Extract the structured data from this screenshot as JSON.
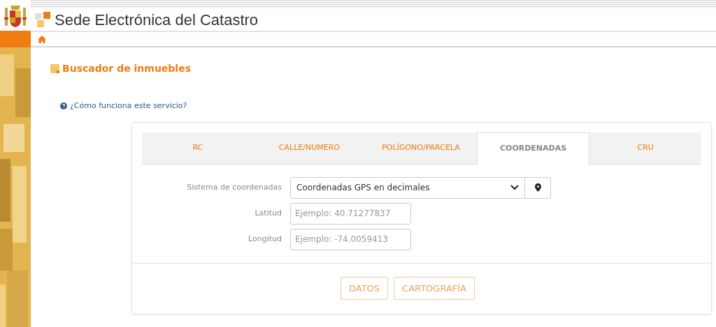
{
  "header": {
    "title": "Sede Electrónica del Catastro"
  },
  "page": {
    "heading": "Buscador de inmuebles",
    "help_link": "¿Cómo funciona este servicio?"
  },
  "tabs": [
    {
      "label": "RC",
      "selected": false
    },
    {
      "label": "CALLE/NUMERO",
      "selected": false
    },
    {
      "label": "POLÍGONO/PARCELA",
      "selected": false
    },
    {
      "label": "COORDENADAS",
      "selected": true
    },
    {
      "label": "CRU",
      "selected": false
    }
  ],
  "form": [
    {
      "kind": "select",
      "label": "Sistema de coordenadas",
      "value": "Coordenadas GPS en decimales"
    },
    {
      "kind": "input",
      "label": "Latitud",
      "placeholder": "Ejemplo: 40.71277837"
    },
    {
      "kind": "input",
      "label": "Longitud",
      "placeholder": "Ejemplo: -74.0059413"
    }
  ],
  "buttons": [
    "DATOS",
    "CARTOGRAFÍA"
  ]
}
